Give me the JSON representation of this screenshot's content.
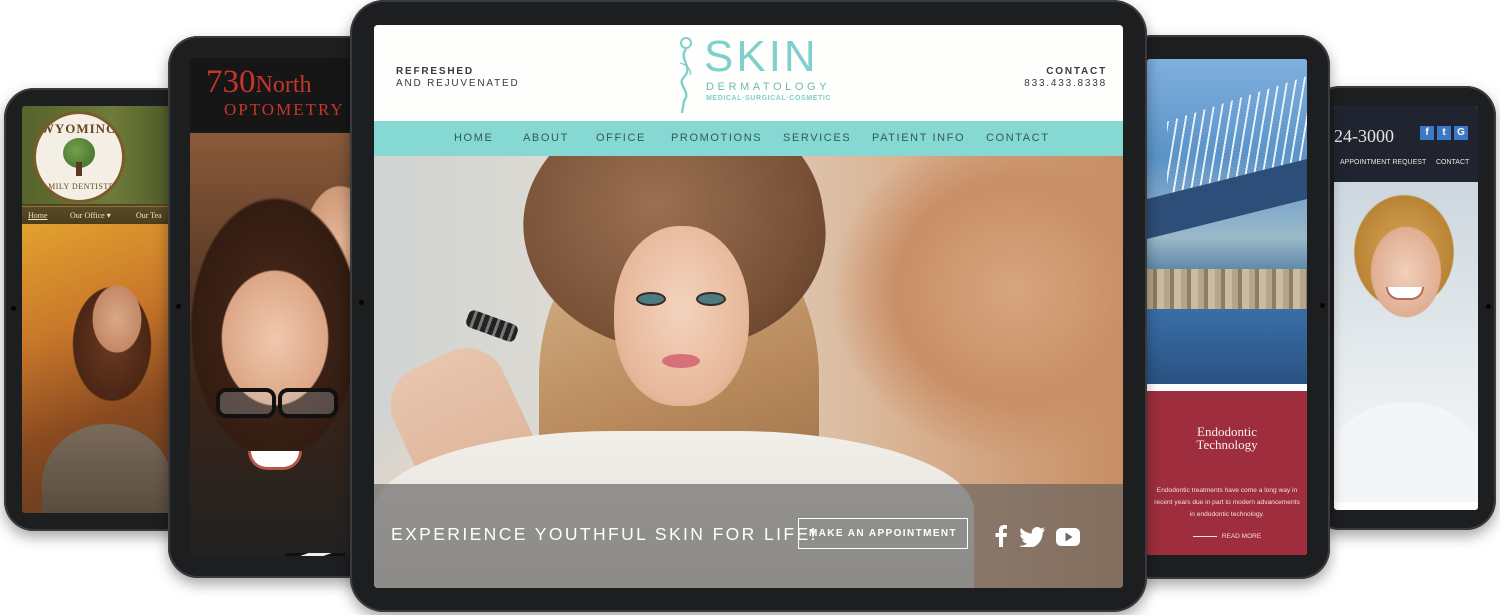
{
  "wyoming": {
    "logo_top": "WYOMING",
    "logo_bottom": "FAMILY DENTISTRY",
    "nav": [
      "Home",
      "Our Office",
      "Our Tea"
    ]
  },
  "north730": {
    "logo_number": "730",
    "logo_word": "North",
    "logo_line2": "OPTOMETRY"
  },
  "skin": {
    "tagline_line1": "REFRESHED",
    "tagline_line2": "AND REJUVENATED",
    "logo_name": "SKIN",
    "logo_sub": "DERMATOLOGY",
    "logo_sub2": "MEDICAL·SURGICAL·COSMETIC",
    "contact_label": "CONTACT",
    "contact_phone": "833.433.8338",
    "nav": [
      "HOME",
      "ABOUT",
      "OFFICE",
      "PROMOTIONS",
      "SERVICES",
      "PATIENT INFO",
      "CONTACT"
    ],
    "cta_text": "EXPERIENCE YOUTHFUL SKIN FOR LIFE!",
    "cta_button": "MAKE AN APPOINTMENT",
    "social_icons": [
      "facebook-icon",
      "twitter-icon",
      "youtube-icon"
    ]
  },
  "endo": {
    "title_line1": "Endodontic",
    "title_line2": "Technology",
    "body": "Endodontic treatments have come a long way in recent years due in part to modern advancements in endodontic technology.",
    "read_more": "READ MORE"
  },
  "farright": {
    "phone": "24-3000",
    "nav": [
      "APPOINTMENT REQUEST",
      "CONTACT"
    ],
    "social_icons": [
      "facebook-icon",
      "twitter-icon",
      "google-plus-icon"
    ]
  },
  "colors": {
    "skin_teal": "#86d8d2",
    "skin_logo": "#7fd0ca",
    "north_red": "#c7352c",
    "endo_red": "#9e2e3d",
    "tablet_frame": "#1d1e20"
  }
}
